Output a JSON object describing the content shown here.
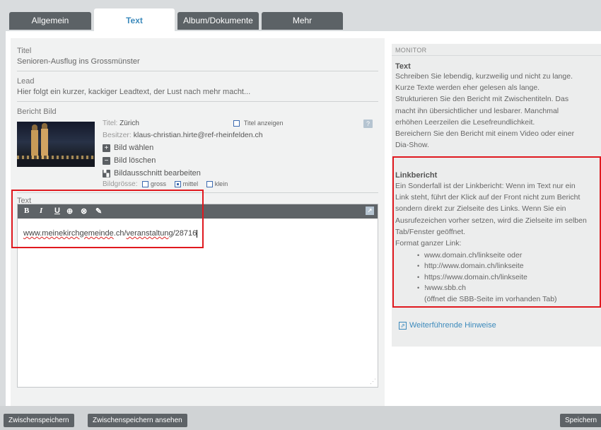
{
  "tabs": [
    {
      "label": "Allgemein"
    },
    {
      "label": "Text"
    },
    {
      "label": "Album/Dokumente"
    },
    {
      "label": "Mehr"
    }
  ],
  "form": {
    "titel_label": "Titel",
    "titel_value": "Senioren-Ausflug ins Grossmünster",
    "lead_label": "Lead",
    "lead_value": "Hier folgt ein kurzer, kackiger Leadtext, der Lust nach mehr macht...",
    "bild_label": "Bericht Bild",
    "picture": {
      "titel_key": "Titel:",
      "titel_val": "Zürich",
      "titel_anzeigen": "Titel anzeigen",
      "besitzer_key": "Besitzer:",
      "besitzer_val": "klaus-christian.hirte@ref-rheinfelden.ch",
      "bild_waehlen": "Bild wählen",
      "bild_loeschen": "Bild löschen",
      "bildausschnitt": "Bildausschnitt bearbeiten",
      "groesse_label": "Bildgrösse:",
      "groesse_options": [
        "gross",
        "mittel",
        "klein"
      ],
      "groesse_selected": "mittel"
    },
    "text_label": "Text",
    "toolbar": {
      "bold": "B",
      "italic": "I",
      "underline": "U"
    },
    "editor": {
      "part1": "www.meinekirchgemeinde",
      "part2": ".ch/",
      "part3": "veranstaltung",
      "part4": "/28716"
    }
  },
  "monitor": {
    "header": "MONITOR",
    "text_title": "Text",
    "text_body": [
      "Schreiben Sie lebendig, kurzweilig und nicht zu lange.",
      "Kurze Texte werden eher gelesen als lange.",
      "Strukturieren Sie den Bericht mit Zwischentiteln. Das",
      "macht ihn übersichtlicher und lesbarer. Manchmal",
      "erhöhen Leerzeilen die Lesefreundlichkeit.",
      "Bereichern Sie den Bericht mit einem Video oder einer",
      "Dia-Show."
    ],
    "link_title": "Linkbericht",
    "link_body": [
      "Ein Sonderfall ist der Linkbericht: Wenn im Text nur ein",
      "Link steht, führt der Klick auf der Front nicht zum Bericht",
      "sondern direkt zur Zielseite des Links. Wenn Sie ein",
      "Ausrufezeichen vorher setzen, wird die Zielseite im selben",
      "Tab/Fenster geöffnet.",
      "Format ganzer Link:"
    ],
    "link_list": [
      "www.domain.ch/linkseite oder",
      "http://www.domain.ch/linkseite",
      "https://www.domain.ch/linkseite",
      "!www.sbb.ch"
    ],
    "link_note": "(öffnet die SBB-Seite im vorhanden Tab)",
    "weiter_link": "Weiterführende Hinweise"
  },
  "bottom": {
    "zwischenspeichern": "Zwischenspeichern",
    "zwischenspeichern_ansehen": "Zwischenspeichern ansehen",
    "speichern": "Speichern"
  },
  "colors": {
    "accent": "#3c8abc",
    "dark": "#5e6367",
    "highlight": "#e0191f"
  }
}
